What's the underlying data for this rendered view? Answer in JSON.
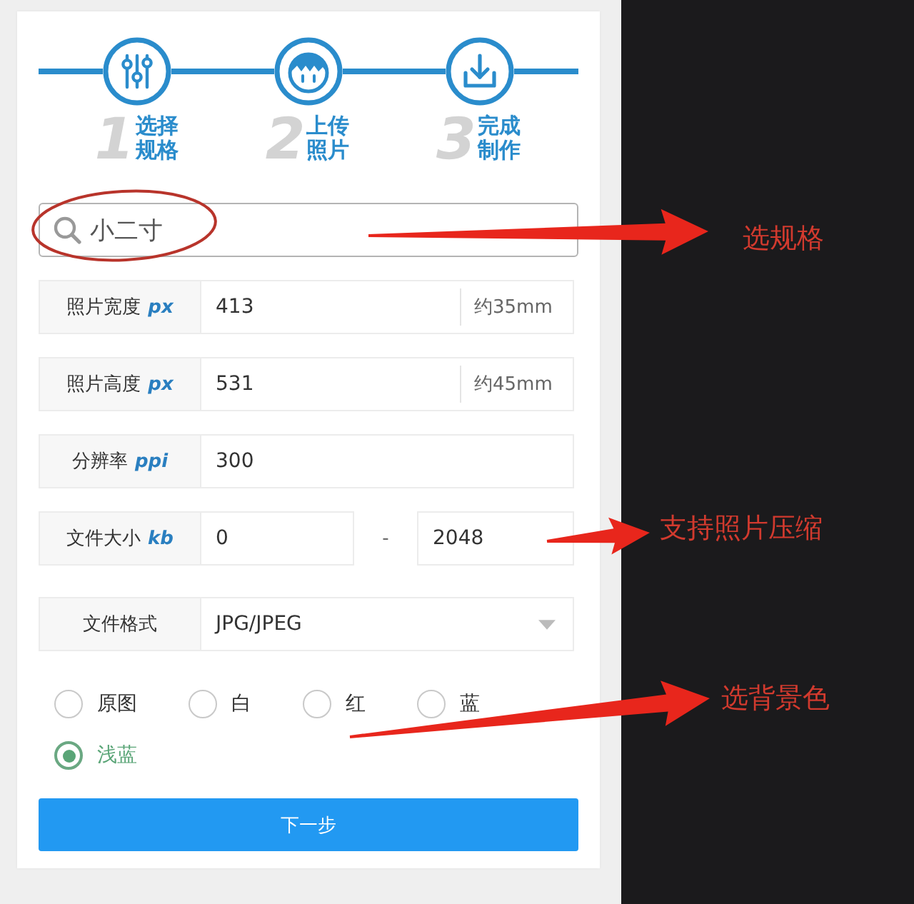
{
  "steps": [
    {
      "number": "1",
      "label": "选择规格"
    },
    {
      "number": "2",
      "label": "上传照片"
    },
    {
      "number": "3",
      "label": "完成制作"
    }
  ],
  "search": {
    "value": "小二寸"
  },
  "fields": [
    {
      "kind": "single",
      "label": "照片宽度",
      "unit": "px",
      "value": "413",
      "suffix": "约35mm"
    },
    {
      "kind": "single",
      "label": "照片高度",
      "unit": "px",
      "value": "531",
      "suffix": "约45mm"
    },
    {
      "kind": "single",
      "label": "分辨率",
      "unit": "ppi",
      "value": "300"
    },
    {
      "kind": "range",
      "label": "文件大小",
      "unit": "kb",
      "min": "0",
      "separator": "-",
      "max": "2048"
    },
    {
      "kind": "select",
      "label": "文件格式",
      "value": "JPG/JPEG"
    }
  ],
  "background_options": [
    {
      "label": "原图",
      "selected": false
    },
    {
      "label": "白",
      "selected": false
    },
    {
      "label": "红",
      "selected": false
    },
    {
      "label": "蓝",
      "selected": false
    },
    {
      "label": "浅蓝",
      "selected": true
    }
  ],
  "next_button": {
    "label": "下一步"
  },
  "annotations": [
    {
      "text": "选规格"
    },
    {
      "text": "支持照片压缩"
    },
    {
      "text": "选背景色"
    }
  ]
}
